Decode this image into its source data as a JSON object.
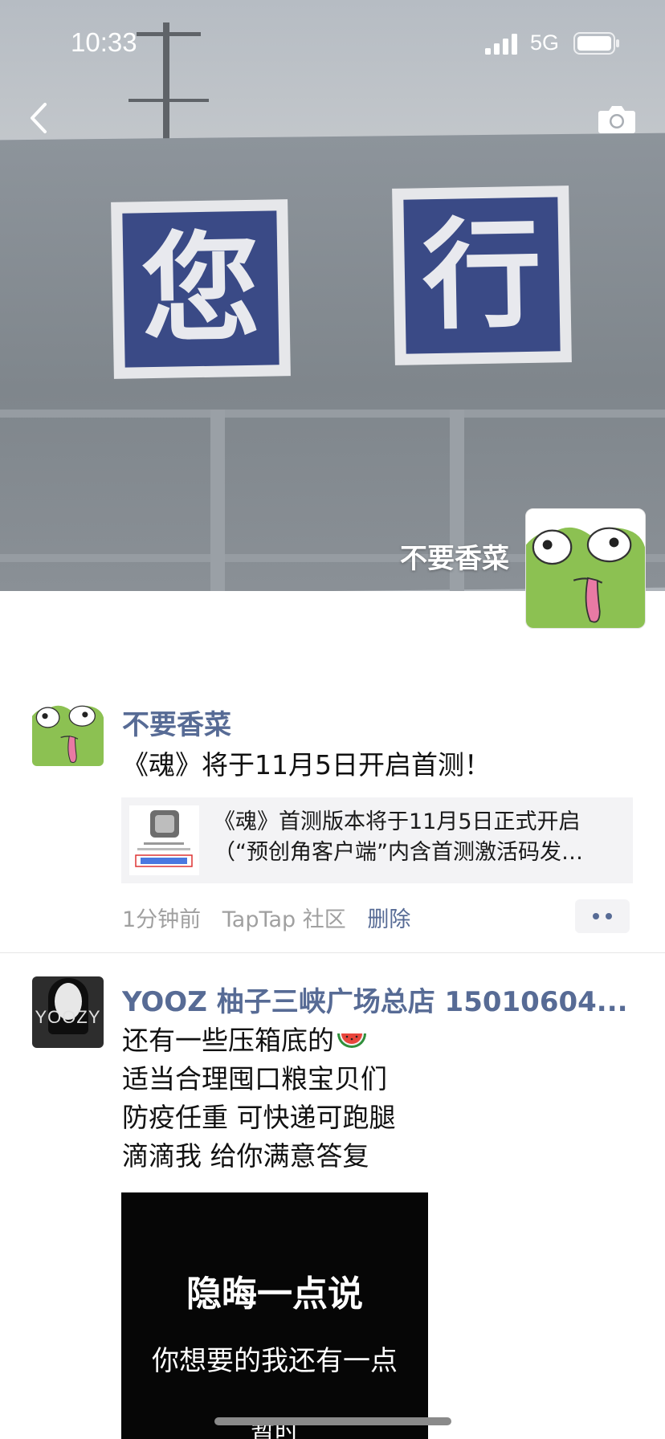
{
  "status_bar": {
    "time": "10:33",
    "network": "5G"
  },
  "nav": {
    "back_icon": "chevron-left-icon",
    "camera_icon": "camera-icon"
  },
  "cover": {
    "sign_left": "您",
    "sign_right": "行",
    "user_name": "不要香菜"
  },
  "posts": [
    {
      "name": "不要香菜",
      "text": "《魂》将于11月5日开启首测！",
      "share": {
        "title_line1": "《魂》首测版本将于11月5日正式开启",
        "title_line2": "（“预创角客户端”内含首测激活码发…"
      },
      "time": "1分钟前",
      "source": "TapTap 社区",
      "delete_label": "删除"
    },
    {
      "name": "YOOZ 柚子三峡广场总店 15010604...",
      "avatar_text": "YOOZY",
      "lines": [
        "还有一些压箱底的",
        "适当合理囤口粮宝贝们",
        "防疫任重 可快递可跑腿",
        "滴滴我 给你满意答复"
      ],
      "image_text": {
        "line1": "隐晦一点说",
        "line2": "你想要的我还有一点",
        "line3": "暂时"
      }
    }
  ],
  "colors": {
    "link_blue": "#576b95",
    "meta_gray": "#a0a0a0",
    "frog_green": "#8cc152"
  }
}
